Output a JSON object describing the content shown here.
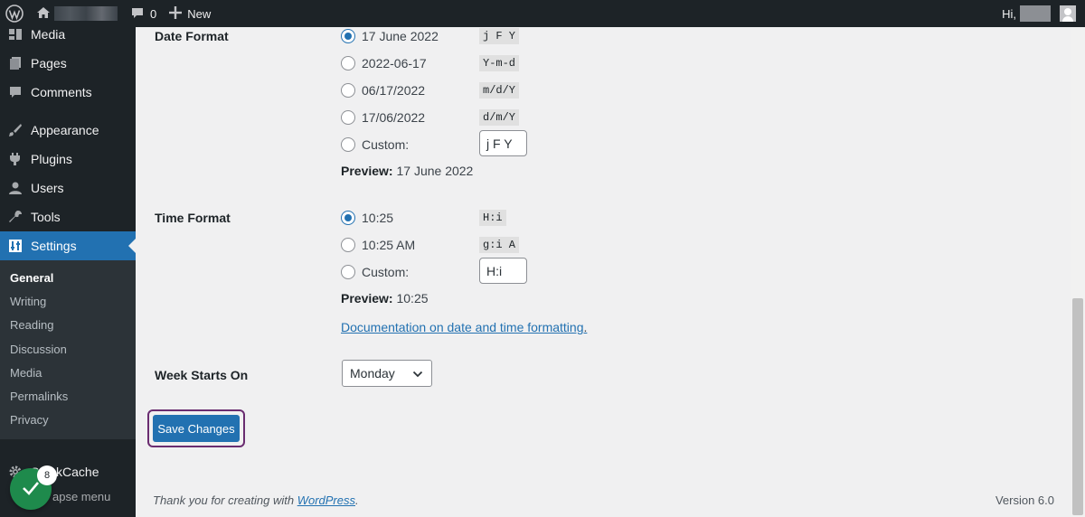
{
  "adminbar": {
    "comments_count": "0",
    "new_label": "New",
    "greeting": "Hi,"
  },
  "sidebar": {
    "items": [
      {
        "label": "Media",
        "icon": "media-icon"
      },
      {
        "label": "Pages",
        "icon": "pages-icon"
      },
      {
        "label": "Comments",
        "icon": "comments-icon"
      },
      {
        "label": "Appearance",
        "icon": "appearance-icon"
      },
      {
        "label": "Plugins",
        "icon": "plugins-icon"
      },
      {
        "label": "Users",
        "icon": "users-icon"
      },
      {
        "label": "Tools",
        "icon": "tools-icon"
      },
      {
        "label": "Settings",
        "icon": "settings-icon"
      }
    ],
    "submenu": [
      "General",
      "Writing",
      "Reading",
      "Discussion",
      "Media",
      "Permalinks",
      "Privacy"
    ],
    "stackcache": "StackCache",
    "collapse": "apse menu",
    "badge_count": "8"
  },
  "date_format": {
    "label": "Date Format",
    "options": [
      {
        "label": "17 June 2022",
        "code": "j F Y"
      },
      {
        "label": "2022-06-17",
        "code": "Y-m-d"
      },
      {
        "label": "06/17/2022",
        "code": "m/d/Y"
      },
      {
        "label": "17/06/2022",
        "code": "d/m/Y"
      },
      {
        "label": "Custom:",
        "code": ""
      }
    ],
    "custom_value": "j F Y",
    "preview_label": "Preview:",
    "preview_value": "17 June 2022"
  },
  "time_format": {
    "label": "Time Format",
    "options": [
      {
        "label": "10:25",
        "code": "H:i"
      },
      {
        "label": "10:25 AM",
        "code": "g:i A"
      },
      {
        "label": "Custom:",
        "code": ""
      }
    ],
    "custom_value": "H:i",
    "preview_label": "Preview:",
    "preview_value": "10:25",
    "doc_link": "Documentation on date and time formatting",
    "doc_suffix": "."
  },
  "week_starts": {
    "label": "Week Starts On",
    "value": "Monday"
  },
  "save_label": "Save Changes",
  "footer": {
    "thanks_prefix": "Thank you for creating with ",
    "thanks_link": "WordPress",
    "thanks_suffix": ".",
    "version": "Version 6.0"
  },
  "colors": {
    "accent": "#2271b1",
    "admin_dark": "#1d2327",
    "badge_green": "#1e8a4c",
    "focus_ring": "#6a2c70"
  }
}
